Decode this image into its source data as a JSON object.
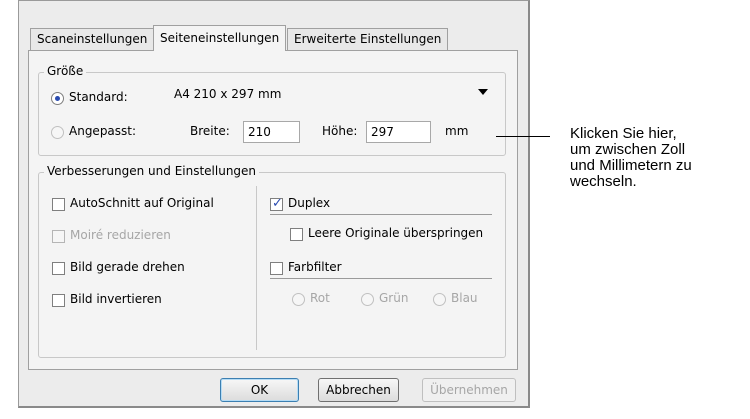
{
  "tabs": [
    {
      "label": "Scaneinstellungen",
      "active": false
    },
    {
      "label": "Seiteneinstellungen",
      "active": true
    },
    {
      "label": "Erweiterte Einstellungen",
      "active": false
    }
  ],
  "size_group": {
    "legend": "Größe",
    "standard_label": "Standard:",
    "standard_value": "A4 210 x 297 mm",
    "custom_label": "Angepasst:",
    "width_label": "Breite:",
    "width_value": "210",
    "height_label": "Höhe:",
    "height_value": "297",
    "unit_label": "mm"
  },
  "enhancements_group": {
    "legend": "Verbesserungen und Einstellungen",
    "autocrop": "AutoSchnitt auf Original",
    "moire": "Moiré reduzieren",
    "deskew": "Bild gerade drehen",
    "invert": "Bild invertieren",
    "duplex": "Duplex",
    "skip_blank": "Leere Originale überspringen",
    "color_filter": "Farbfilter",
    "filter_red": "Rot",
    "filter_green": "Grün",
    "filter_blue": "Blau"
  },
  "buttons": {
    "ok": "OK",
    "cancel": "Abbrechen",
    "apply": "Übernehmen"
  },
  "callout": {
    "line1": "Klicken Sie hier,",
    "line2": "um zwischen Zoll",
    "line3": "und Millimetern zu",
    "line4": "wechseln."
  },
  "colors": {
    "accent": "#2a4bb0",
    "dialog_bg": "#ececec",
    "panel_bg": "#f4f4f4"
  }
}
